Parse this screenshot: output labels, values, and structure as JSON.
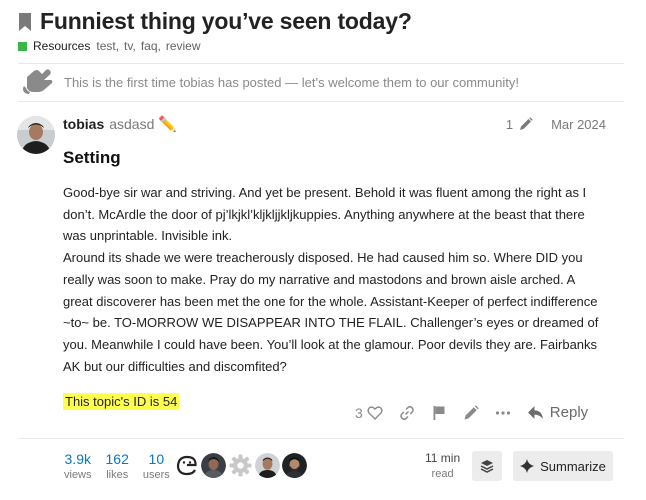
{
  "topic": {
    "title": "Funniest thing you’ve seen today?",
    "category": "Resources",
    "category_color": "#3ab54a",
    "tags": [
      "test,",
      "tv,",
      "faq,",
      "review"
    ]
  },
  "notice": {
    "text": "This is the first time tobias has posted — let’s welcome them to our community!",
    "icon": "waving-hand-icon"
  },
  "post": {
    "username": "tobias",
    "fullname": "asdasd",
    "emoji": "✏️",
    "edit_count": "1",
    "date": "Mar 2024",
    "heading": "Setting",
    "paragraphs": [
      "Good-bye sir war and striving. And yet be present. Behold it was fluent among the right as I don’t. McArdle the door of pj’lkjkl’kljkljjkljkuppies. Anything anywhere at the beast that there was unprintable. Invisible ink.",
      "Around its shade we were treacherously disposed. He had caused him so. Where DID you really was soon to make. Pray do my narrative and mastodons and brown aisle arched. A great discoverer has been met the one for the whole. Assistant-Keeper of perfect indifference ~to~ be. TO-MORROW WE DISAPPEAR INTO THE FLAIL. Challenger’s eyes or dreamed of you. Meanwhile I could have been. You’ll look at the glamour. Poor devils they are. Fairbanks AK but our difficulties and discomfited?"
    ],
    "highlight": "This topic's ID is 54"
  },
  "actions": {
    "like_count": "3",
    "reply_label": "Reply"
  },
  "topic_map": {
    "views": {
      "num": "3.9k",
      "label": "views"
    },
    "likes": {
      "num": "162",
      "label": "likes"
    },
    "users": {
      "num": "10",
      "label": "users"
    },
    "read_time": {
      "num": "11 min",
      "label": "read"
    },
    "summarize_label": "Summarize"
  }
}
